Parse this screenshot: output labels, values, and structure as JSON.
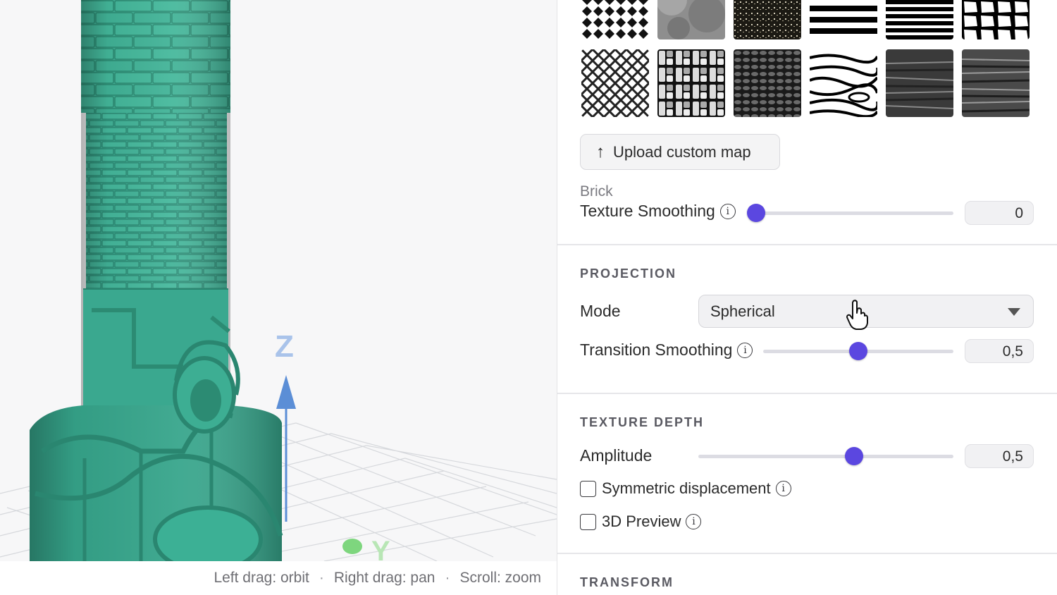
{
  "viewport": {
    "axis_z": "Z",
    "axis_y": "Y",
    "hints": [
      "Left drag: orbit",
      "Right drag: pan",
      "Scroll: zoom"
    ],
    "hint_separator": "·",
    "colors": {
      "model": "#3aa88f",
      "z_axis": "#5b8ed6",
      "y_axis": "#7ed67e",
      "grid": "#d4d6da"
    }
  },
  "textures": {
    "items": [
      {
        "icon": "diamond-pattern-icon"
      },
      {
        "icon": "cloud-noise-icon"
      },
      {
        "icon": "speckle-noise-icon"
      },
      {
        "icon": "thick-stripes-icon"
      },
      {
        "icon": "thin-stripes-icon"
      },
      {
        "icon": "voronoi-cells-icon"
      },
      {
        "icon": "herringbone-icon"
      },
      {
        "icon": "basket-weave-icon"
      },
      {
        "icon": "knit-pattern-icon"
      },
      {
        "icon": "wood-grain-icon"
      },
      {
        "icon": "dark-wood-icon"
      },
      {
        "icon": "bark-wood-icon"
      }
    ],
    "upload_label": "Upload custom map",
    "selected_name": "Brick"
  },
  "texture_smoothing": {
    "label": "Texture Smoothing",
    "value": "0",
    "fraction": 0.0
  },
  "projection": {
    "title": "PROJECTION",
    "mode_label": "Mode",
    "mode_value": "Spherical",
    "transition_label": "Transition Smoothing",
    "transition_value": "0,5",
    "transition_fraction": 0.5
  },
  "texture_depth": {
    "title": "TEXTURE DEPTH",
    "amplitude_label": "Amplitude",
    "amplitude_value": "0,5",
    "amplitude_fraction": 0.61,
    "symmetric_label": "Symmetric displacement",
    "preview_label": "3D Preview"
  },
  "transform": {
    "title": "TRANSFORM"
  },
  "accent_color": "#5b47e0"
}
